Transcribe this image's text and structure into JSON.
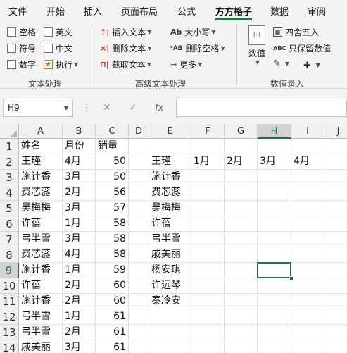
{
  "menu": {
    "tabs": [
      {
        "label": "文件"
      },
      {
        "label": "开始"
      },
      {
        "label": "插入"
      },
      {
        "label": "页面布局"
      },
      {
        "label": "公式"
      },
      {
        "label": "方方格子"
      },
      {
        "label": "数据"
      },
      {
        "label": "审阅"
      }
    ],
    "active": "方方格子"
  },
  "ribbon": {
    "text_processing": {
      "checkboxes": [
        "空格",
        "英文",
        "符号",
        "中文",
        "数字"
      ],
      "execute": "执行",
      "group_label": "文本处理"
    },
    "advanced_text": {
      "insert_text": "插入文本",
      "delete_text": "删除文本",
      "extract_text": "截取文本",
      "case": "大小写",
      "delete_spaces": "删除空格",
      "more": "更多",
      "group_label": "高级文本处理"
    },
    "numeric_entry": {
      "value": "数值",
      "round": "四舍五入",
      "keep_values": "只保留数值",
      "group_label": "数值录入"
    }
  },
  "formula_bar": {
    "name_box": "H9",
    "fx": "fx",
    "formula": ""
  },
  "sheet": {
    "columns": [
      "A",
      "B",
      "C",
      "D",
      "E",
      "F",
      "G",
      "H",
      "I",
      "J"
    ],
    "selected_column": "H",
    "selected_row": "9",
    "rows": [
      {
        "n": "1",
        "A": "姓名",
        "B": "月份",
        "C": "销量",
        "E": "",
        "F": "",
        "G": "",
        "H": "",
        "I": ""
      },
      {
        "n": "2",
        "A": "王瑾",
        "B": "4月",
        "C": "50",
        "E": "王瑾",
        "F": "1月",
        "G": "2月",
        "H": "3月",
        "I": "4月"
      },
      {
        "n": "3",
        "A": "施计香",
        "B": "3月",
        "C": "50",
        "E": "施计香",
        "F": "",
        "G": "",
        "H": "",
        "I": ""
      },
      {
        "n": "4",
        "A": "费芯蕊",
        "B": "2月",
        "C": "56",
        "E": "费芯蕊",
        "F": "",
        "G": "",
        "H": "",
        "I": ""
      },
      {
        "n": "5",
        "A": "吴梅梅",
        "B": "3月",
        "C": "57",
        "E": "吴梅梅",
        "F": "",
        "G": "",
        "H": "",
        "I": ""
      },
      {
        "n": "6",
        "A": "许蓓",
        "B": "1月",
        "C": "58",
        "E": "许蓓",
        "F": "",
        "G": "",
        "H": "",
        "I": ""
      },
      {
        "n": "7",
        "A": "弓半雪",
        "B": "3月",
        "C": "58",
        "E": "弓半雪",
        "F": "",
        "G": "",
        "H": "",
        "I": ""
      },
      {
        "n": "8",
        "A": "费芯蕊",
        "B": "4月",
        "C": "58",
        "E": "戚美丽",
        "F": "",
        "G": "",
        "H": "",
        "I": ""
      },
      {
        "n": "9",
        "A": "施计香",
        "B": "1月",
        "C": "59",
        "E": "杨安琪",
        "F": "",
        "G": "",
        "H": "",
        "I": ""
      },
      {
        "n": "10",
        "A": "许蓓",
        "B": "2月",
        "C": "60",
        "E": "许远琴",
        "F": "",
        "G": "",
        "H": "",
        "I": ""
      },
      {
        "n": "11",
        "A": "施计香",
        "B": "2月",
        "C": "60",
        "E": "秦冷安",
        "F": "",
        "G": "",
        "H": "",
        "I": ""
      },
      {
        "n": "12",
        "A": "弓半雪",
        "B": "1月",
        "C": "61",
        "E": "",
        "F": "",
        "G": "",
        "H": "",
        "I": ""
      },
      {
        "n": "13",
        "A": "弓半雪",
        "B": "2月",
        "C": "61",
        "E": "",
        "F": "",
        "G": "",
        "H": "",
        "I": ""
      },
      {
        "n": "14",
        "A": "戚美丽",
        "B": "3月",
        "C": "61",
        "E": "",
        "F": "",
        "G": "",
        "H": "",
        "I": ""
      }
    ]
  }
}
